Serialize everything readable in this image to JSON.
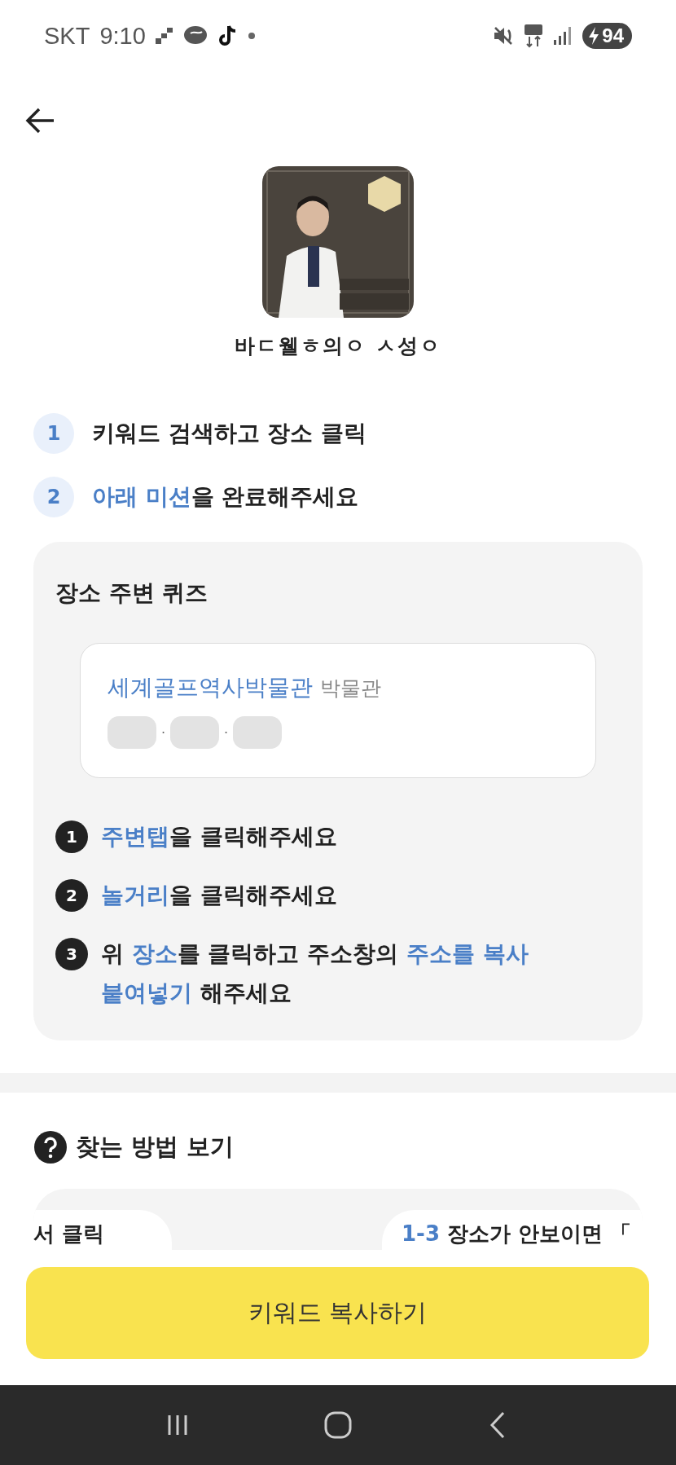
{
  "status_bar": {
    "carrier": "SKT",
    "time": "9:10",
    "battery": "94"
  },
  "place": {
    "name": "바ㄷ웰ㅎ의ㅇ ㅅ성ㅇ"
  },
  "steps": [
    {
      "number": "1",
      "segments": [
        {
          "text": "키워드 검색하고 장소 클릭",
          "highlight": false
        }
      ]
    },
    {
      "number": "2",
      "segments": [
        {
          "text": "아래 미션",
          "highlight": true
        },
        {
          "text": "을 완료해주세요",
          "highlight": false
        }
      ]
    }
  ],
  "quiz": {
    "title": "장소 주변 퀴즈",
    "place_name": "세계골프역사박물관",
    "category": "박물관",
    "address_separators": [
      "·",
      "·"
    ],
    "instructions": [
      {
        "number": "1",
        "segments": [
          {
            "text": "주변탭",
            "highlight": true
          },
          {
            "text": "을 클릭해주세요",
            "highlight": false
          }
        ]
      },
      {
        "number": "2",
        "segments": [
          {
            "text": "놀거리",
            "highlight": true
          },
          {
            "text": "을 클릭해주세요",
            "highlight": false
          }
        ]
      },
      {
        "number": "3",
        "segments": [
          {
            "text": "위 ",
            "highlight": false
          },
          {
            "text": "장소",
            "highlight": true
          },
          {
            "text": "를 클릭하고 주소창의 ",
            "highlight": false
          },
          {
            "text": "주소를 복사 붙여넣기",
            "highlight": true
          },
          {
            "text": " 해주세요",
            "highlight": false
          }
        ]
      }
    ]
  },
  "help": {
    "title": "찾는 방법 보기",
    "cards": [
      {
        "segments": [
          {
            "text": "서 클릭",
            "highlight": false
          }
        ]
      },
      {
        "segments": [
          {
            "text": "1-3",
            "highlight": true
          },
          {
            "text": " 장소가 안보이면 「",
            "highlight": false
          }
        ]
      }
    ]
  },
  "copy_button": {
    "label": "키워드 복사하기"
  }
}
